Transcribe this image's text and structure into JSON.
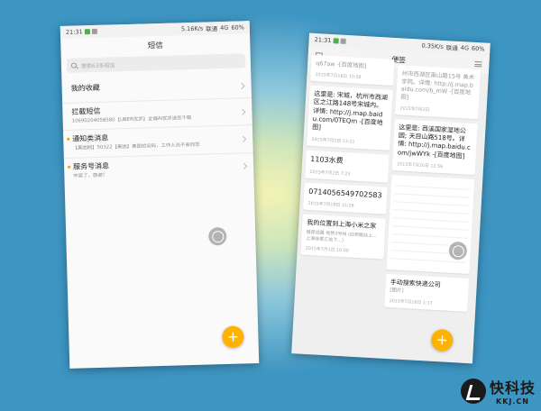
{
  "left_phone": {
    "status": {
      "time": "21:31",
      "net": "5.16K/s",
      "carrier": "联通",
      "signal": "4G",
      "battery": "60%"
    },
    "title": "短信",
    "search_placeholder": "搜索63条短信",
    "sections": [
      {
        "title": "我的收藏",
        "preview": ""
      },
      {
        "title": "拦截短信",
        "preview": "10690204058580【UBER优步】全城AI优步送您千载",
        "preview2": ""
      },
      {
        "title": "通知类消息",
        "preview": "【美团网】50322【美团】美团验证码，工作人员不会向您",
        "dot": true
      },
      {
        "title": "服务号消息",
        "preview": "中奖了，感谢！",
        "dot": true
      }
    ],
    "fab": "+"
  },
  "right_phone": {
    "status": {
      "time": "21:31",
      "net": "0.35K/s",
      "carrier": "联通",
      "signal": "4G",
      "battery": "60%"
    },
    "title": "便签",
    "col1": [
      {
        "body": "q67aw -[百度地图]",
        "date": "2015年7月18日 10:08",
        "grey": true
      },
      {
        "body": "这里是: 宋城，杭州市西湖区之江路148号宋城内。详情: http://j.map.baidu.com/0TEQm -[百度地图]",
        "date": "2015年7月2日 13:21"
      },
      {
        "body": "1103水费",
        "date": "2015年7月2日 7:23",
        "big": true
      },
      {
        "body": "07140565497025​83",
        "date": "2015年7月18日 15:26",
        "big": true
      },
      {
        "body": "我的位置到上海小米之家",
        "sub": "推荐线路 地铁3号线 (红桥路站上... 上海徐家汇站下...)",
        "date": "2015年7月1日 10:00"
      }
    ],
    "col2": [
      {
        "body": "州市西湖区南山路15号 美术学院。详情: http://j.map.baidu.com/b_mW -[百度地图]",
        "date": "2015年7月2日",
        "grey": true
      },
      {
        "body": "这里是: 西溪国家湿地公园; 天目山路518号。详情: http://j.map.baidu.com/jwWYk -[百度地图]",
        "date": "2015年7月20日 12:56"
      },
      {
        "list": [
          "",
          "",
          "",
          "",
          "",
          "",
          "",
          "",
          "",
          "",
          ""
        ]
      },
      {
        "body": "手动搜索快递公司",
        "sub": "[图片]",
        "date": "2015年7月18日 1:17"
      }
    ],
    "fab": "+"
  },
  "watermark": {
    "cn": "快科技",
    "en": "KKJ.CN"
  }
}
